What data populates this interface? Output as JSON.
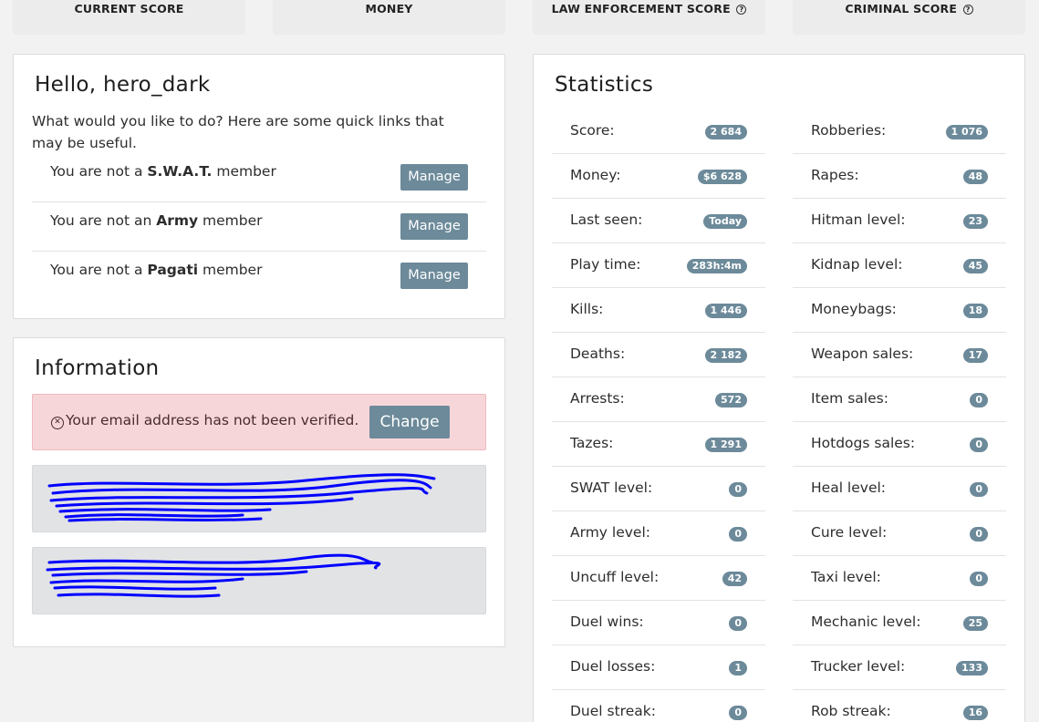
{
  "top_cards": [
    {
      "label": "CURRENT SCORE",
      "help": false
    },
    {
      "label": "MONEY",
      "help": false
    },
    {
      "label": "LAW ENFORCEMENT SCORE",
      "help": true
    },
    {
      "label": "CRIMINAL SCORE",
      "help": true
    }
  ],
  "welcome": {
    "title": "Hello, hero_dark",
    "intro": "What would you like to do? Here are some quick links that may be useful.",
    "manage_label": "Manage",
    "memberships": [
      {
        "prefix": "You are not a ",
        "group": "S.W.A.T.",
        "suffix": " member"
      },
      {
        "prefix": "You are not an ",
        "group": "Army",
        "suffix": " member"
      },
      {
        "prefix": "You are not a ",
        "group": "Pagati",
        "suffix": " member"
      }
    ]
  },
  "information": {
    "title": "Information",
    "alert_text": "Your email address has not been verified.",
    "change_label": "Change"
  },
  "statistics": {
    "title": "Statistics",
    "left": [
      {
        "label": "Score:",
        "value": "2 684"
      },
      {
        "label": "Money:",
        "value": "$6 628"
      },
      {
        "label": "Last seen:",
        "value": "Today"
      },
      {
        "label": "Play time:",
        "value": "283h:4m"
      },
      {
        "label": "Kills:",
        "value": "1 446"
      },
      {
        "label": "Deaths:",
        "value": "2 182"
      },
      {
        "label": "Arrests:",
        "value": "572"
      },
      {
        "label": "Tazes:",
        "value": "1 291"
      },
      {
        "label": "SWAT level:",
        "value": "0"
      },
      {
        "label": "Army level:",
        "value": "0"
      },
      {
        "label": "Uncuff level:",
        "value": "42"
      },
      {
        "label": "Duel wins:",
        "value": "0"
      },
      {
        "label": "Duel losses:",
        "value": "1"
      },
      {
        "label": "Duel streak:",
        "value": "0"
      }
    ],
    "right": [
      {
        "label": "Robberies:",
        "value": "1 076"
      },
      {
        "label": "Rapes:",
        "value": "48"
      },
      {
        "label": "Hitman level:",
        "value": "23"
      },
      {
        "label": "Kidnap level:",
        "value": "45"
      },
      {
        "label": "Moneybags:",
        "value": "18"
      },
      {
        "label": "Weapon sales:",
        "value": "17"
      },
      {
        "label": "Item sales:",
        "value": "0"
      },
      {
        "label": "Hotdogs sales:",
        "value": "0"
      },
      {
        "label": "Heal level:",
        "value": "0"
      },
      {
        "label": "Cure level:",
        "value": "0"
      },
      {
        "label": "Taxi level:",
        "value": "0"
      },
      {
        "label": "Mechanic level:",
        "value": "25"
      },
      {
        "label": "Trucker level:",
        "value": "133"
      },
      {
        "label": "Rob streak:",
        "value": "16"
      }
    ]
  },
  "colors": {
    "accent": "#6c8a9a",
    "alert_bg": "#f6d6d9",
    "scribble": "#0000ff"
  }
}
